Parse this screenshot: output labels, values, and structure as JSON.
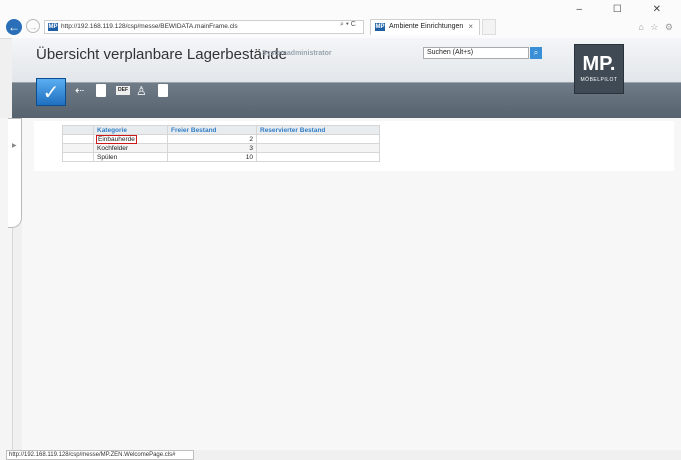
{
  "browser": {
    "url": "http://192.168.119.128/csp/messe/BEWIDATA.mainFrame.cls",
    "address_tools": "⌕ ▾ C",
    "tab_title": "Ambiente Einrichtungen",
    "favicon_text": "MP",
    "window_controls": "– ☐ ✕",
    "right_icons": "⌂ ☆ ⚙"
  },
  "header": {
    "title": "Übersicht verplanbare Lagerbestände",
    "user": "Systemadministrator",
    "search_placeholder": "Suchen (Alt+s)",
    "logo_main": "MP.",
    "logo_sub": "MÖBELPILOT"
  },
  "toolbar": {
    "def_label": "DEF"
  },
  "table": {
    "headers": [
      "Kategorie",
      "Freier Bestand",
      "Reservierter Bestand"
    ],
    "rows": [
      {
        "kategorie": "Einbauherde",
        "frei": "2",
        "reserviert": ""
      },
      {
        "kategorie": "Kochfelder",
        "frei": "3",
        "reserviert": ""
      },
      {
        "kategorie": "Spülen",
        "frei": "10",
        "reserviert": ""
      }
    ]
  },
  "status_bar": {
    "text": "http://192.168.119.128/csp/messe/MP.ZEN.WelcomePage.cls#"
  },
  "colors": {
    "accent": "#2f7ec8",
    "highlight": "#d0181b",
    "header_dark": "#56626e"
  }
}
